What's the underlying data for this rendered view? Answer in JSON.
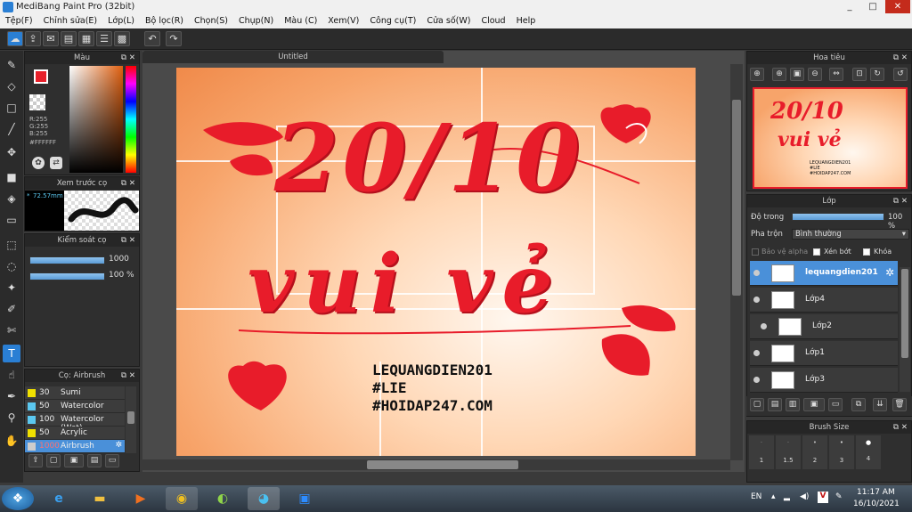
{
  "window": {
    "title": "MediBang Paint Pro (32bit)",
    "minimize": "_",
    "maximize": "□",
    "close": "✕"
  },
  "menu": [
    "Tệp(F)",
    "Chỉnh sửa(E)",
    "Lớp(L)",
    "Bộ lọc(R)",
    "Chọn(S)",
    "Chụp(N)",
    "Màu (C)",
    "Xem(V)",
    "Công cụ(T)",
    "Cửa số(W)",
    "Cloud",
    "Help"
  ],
  "panels": {
    "color": {
      "title": "Màu",
      "r": "R:255",
      "g": "G:255",
      "b": "B:255",
      "hex": "#FFFFFF",
      "primary": "#e8202a",
      "secondary": "#ffffff"
    },
    "preview": {
      "title": "Xem trước cọ",
      "size": "72.57mm",
      "prefix": "*"
    },
    "brushctl": {
      "title": "Kiểm soát cọ",
      "size": "1000",
      "opacity": "100 %"
    },
    "brush": {
      "title": "Cọ: Airbrush",
      "items": [
        {
          "num": "30",
          "name": "Sumi",
          "color": "#f0e000"
        },
        {
          "num": "50",
          "name": "Watercolor",
          "color": "#5bc8f0"
        },
        {
          "num": "100",
          "name": "Watercolor (Wet)",
          "color": "#5bc8f0"
        },
        {
          "num": "50",
          "name": "Acrylic",
          "color": "#f0e000"
        },
        {
          "num": "1000",
          "name": "Airbrush",
          "color": "#cccccc"
        }
      ]
    },
    "navigator": {
      "title": "Hoa tiêu"
    },
    "layers": {
      "title": "Lớp",
      "opacity_label": "Độ trong",
      "opacity_value": "100 %",
      "blend_label": "Pha trộn",
      "blend_value": "Bình thường",
      "protect_alpha": "Bảo vệ alpha",
      "clipping": "Xén bớt",
      "lock": "Khóa",
      "items": [
        {
          "name": "lequangdien201",
          "selected": true
        },
        {
          "name": "Lớp4",
          "selected": false
        },
        {
          "name": "Lớp2",
          "selected": false
        },
        {
          "name": "Lớp1",
          "selected": false
        },
        {
          "name": "Lớp3",
          "selected": false
        }
      ]
    },
    "brushsize": {
      "title": "Brush Size",
      "sizes": [
        "1",
        "1.5",
        "2",
        "3",
        "4"
      ]
    }
  },
  "document": {
    "tab": "Untitled",
    "artwork_text": [
      "20/10",
      "vui vẻ"
    ],
    "watermark_lines": [
      "LEQUANGDIEN201",
      "#LIE",
      "#HOIDAP247.COM"
    ]
  },
  "taskbar": {
    "lang": "EN",
    "time": "11:17 AM",
    "date": "16/10/2021"
  }
}
